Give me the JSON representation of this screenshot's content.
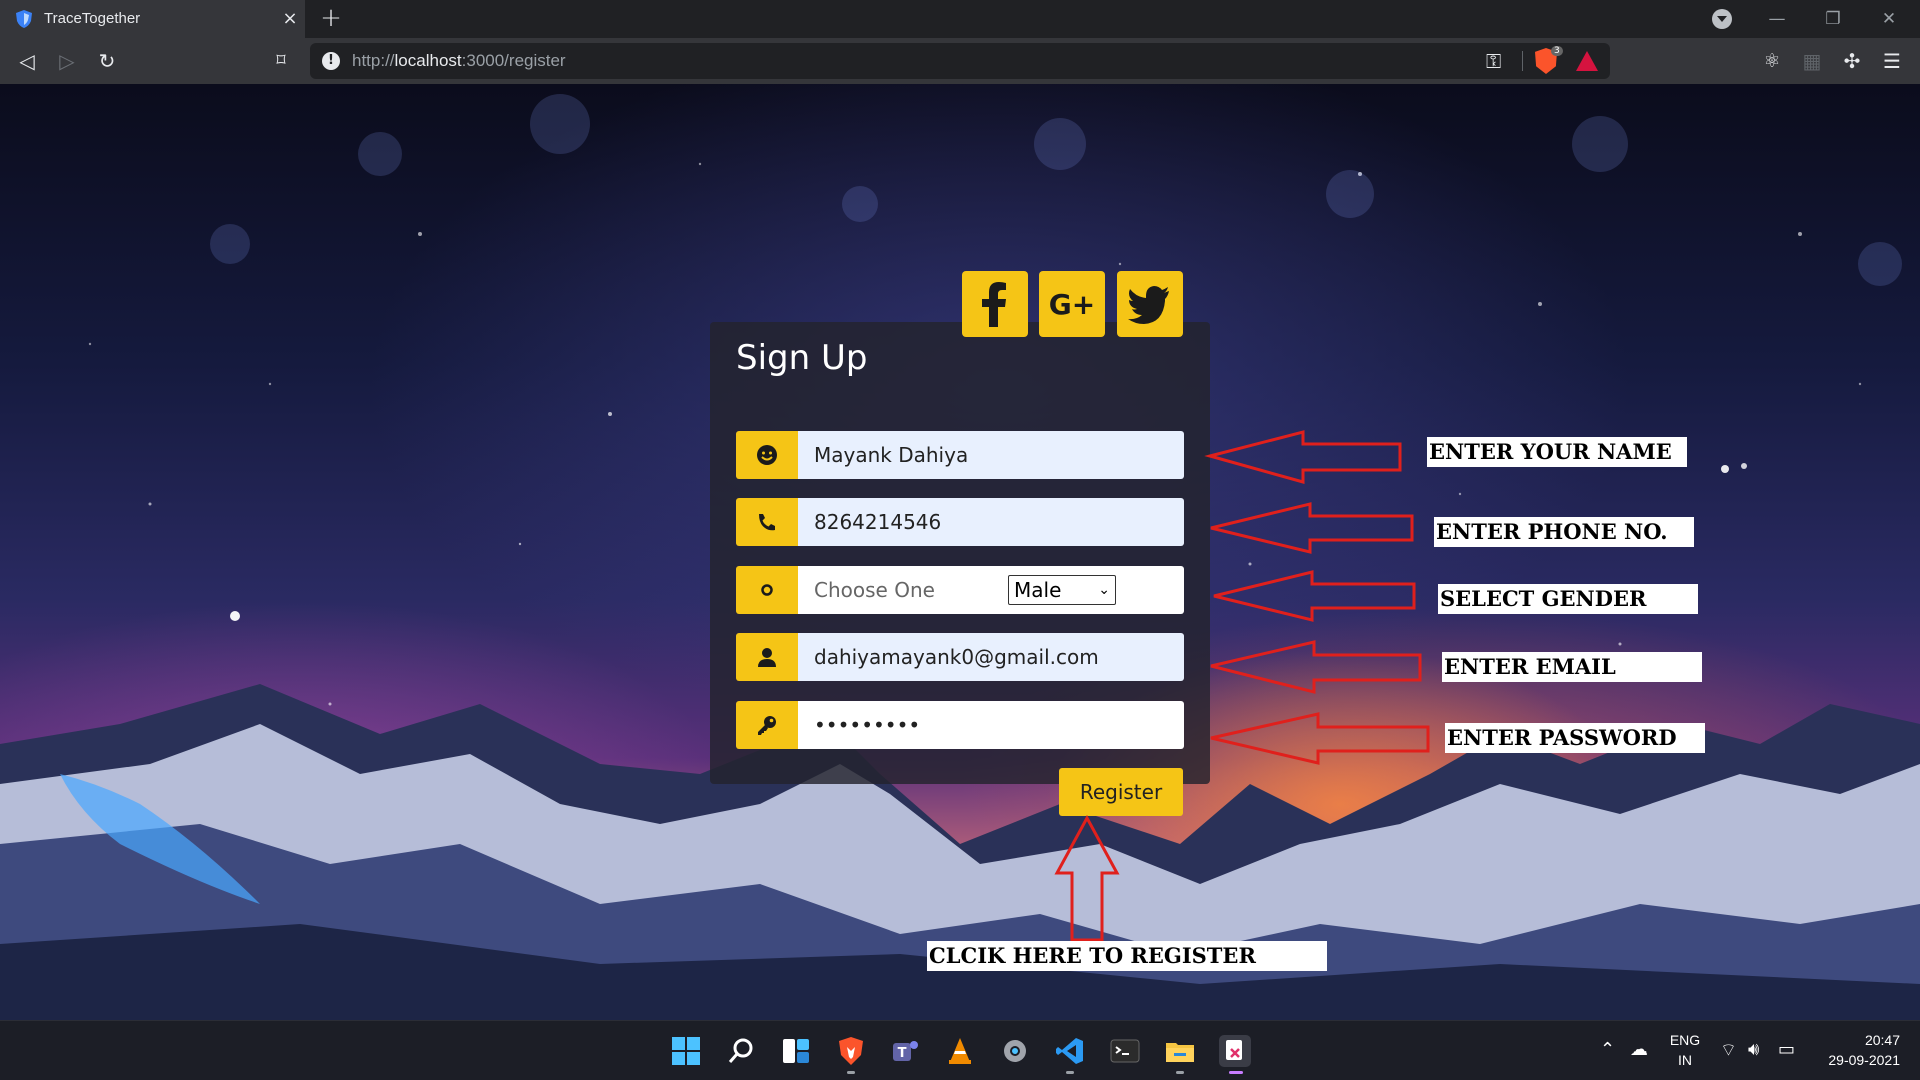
{
  "browser": {
    "tab_title": "TraceTogether",
    "tab_close": "×",
    "new_tab": "+",
    "url_host": "localhost",
    "url_prefix": "http://",
    "url_suffix": ":3000/register",
    "window_minimize": "—",
    "window_restore": "❐",
    "window_close": "✕",
    "brave_badge": "3"
  },
  "form": {
    "title": "Sign Up",
    "name_value": "Mayank Dahiya",
    "phone_value": "8264214546",
    "gender_label": "Choose One",
    "gender_selected": "Male",
    "email_value": "dahiyamayank0@gmail.com",
    "password_value": "•••••••••",
    "register_label": "Register"
  },
  "annotations": {
    "name": "Enter your name",
    "phone": "Enter phone no.",
    "gender": "Select gender",
    "email": "Enter email",
    "password": "Enter password",
    "register": "Clcik here to register"
  },
  "taskbar": {
    "language": "ENG",
    "region": "IN",
    "time": "20:47",
    "date": "29-09-2021"
  },
  "colors": {
    "accent": "#f5c516",
    "arrow": "#e0201c"
  }
}
